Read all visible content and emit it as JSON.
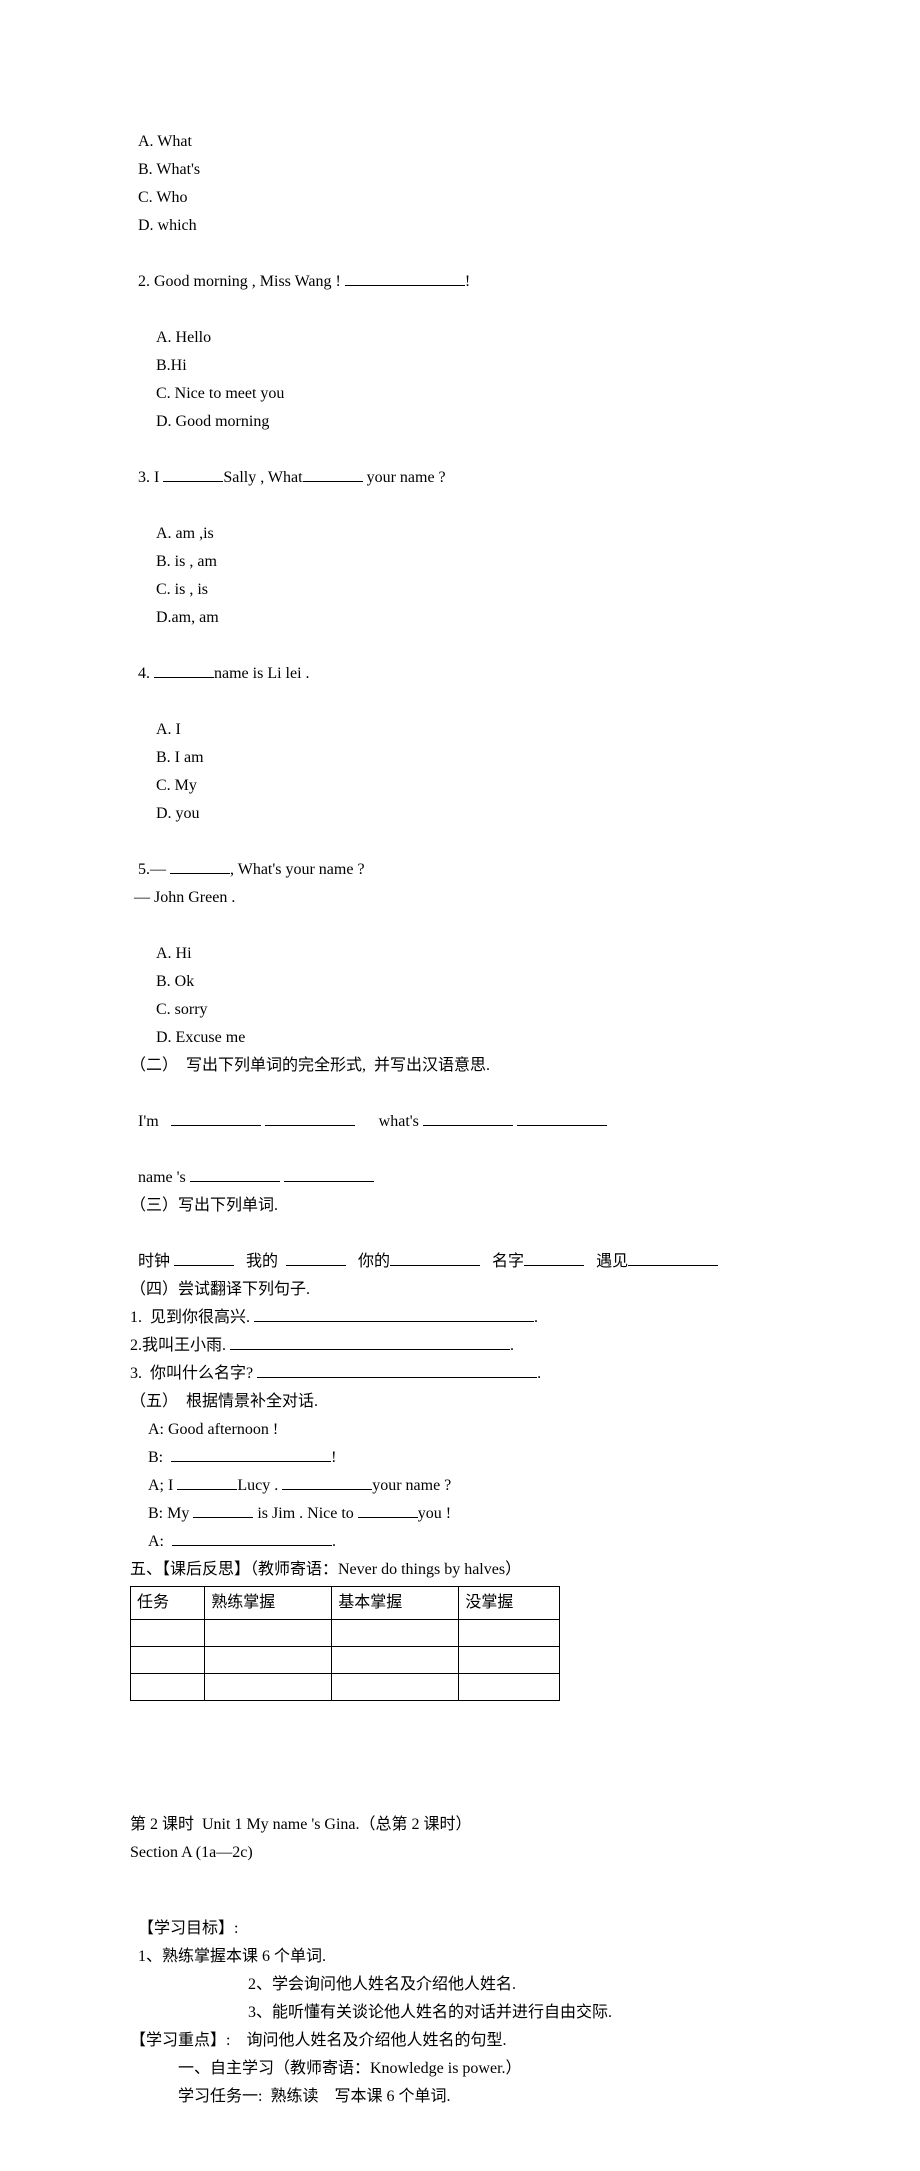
{
  "q1": {
    "a": "A. What",
    "b": "B. What's",
    "c": "C. Who",
    "d": "D. which"
  },
  "q2": {
    "stem_pre": "2. Good morning , Miss Wang ! ",
    "stem_post": "!",
    "a": "A. Hello",
    "b": "B.Hi",
    "c": "C. Nice to meet you",
    "d": "D. Good morning"
  },
  "q3": {
    "stem_pre": "3. I ",
    "stem_mid": "Sally , What",
    "stem_post": " your name ?",
    "a": "A. am ,is",
    "b": "B. is , am",
    "c": "C. is , is",
    "d": "D.am, am"
  },
  "q4": {
    "stem_post": "name is Li lei .",
    "stem_pre": "4. ",
    "a": "A. I",
    "b": "B. I am",
    "c": "C. My",
    "d": "D. you"
  },
  "q5": {
    "stem_pre": "5.— ",
    "stem_post": ", What's your name ?",
    "line2": " — John Green .",
    "a": "A. Hi",
    "b": "B. Ok",
    "c": "C. sorry",
    "d": "D. Excuse me"
  },
  "part2": {
    "title": "（二）  写出下列单词的完全形式,  并写出汉语意思.",
    "im": "I'm   ",
    "whats": "      what's ",
    "names": "name 's "
  },
  "part3": {
    "title": "（三）写出下列单词.",
    "w1": "时钟 ",
    "w2": "   我的  ",
    "w3": "   你的",
    "w4": "   名字",
    "w5": "   遇见"
  },
  "part4": {
    "title": "（四）尝试翻译下列句子.",
    "s1": "1.  见到你很高兴. ",
    "s2": "2.我叫王小雨. ",
    "s3": "3.  你叫什么名字? "
  },
  "part5": {
    "title": "（五）  根据情景补全对话.",
    "a1": "A: Good afternoon !",
    "b1_pre": "B:  ",
    "b1_post": "!",
    "a2_pre": "A; I ",
    "a2_mid": "Lucy . ",
    "a2_post": "your name ?",
    "b2_pre": "B: My ",
    "b2_mid": " is Jim . Nice to ",
    "b2_post": "you !",
    "a3_pre": "A:  "
  },
  "reflect": {
    "title": "五、【课后反思】（教师寄语：Never do things by halves）",
    "h1": "任务",
    "h2": "熟练掌握",
    "h3": "基本掌握",
    "h4": "没掌握"
  },
  "lesson2": {
    "line1": "第 2 课时  Unit 1 My name 's Gina.（总第 2 课时）",
    "line2": "Section A (1a—2c)",
    "obj_title": "【学习目标】:",
    "obj1": "1、熟练掌握本课 6 个单词.",
    "obj2": "2、学会询问他人姓名及介绍他人姓名.",
    "obj3": "3、能听懂有关谈论他人姓名的对话并进行自由交际.",
    "focus": "【学习重点】:    询问他人姓名及介绍他人姓名的句型.",
    "sub1": "一、自主学习（教师寄语：Knowledge is power.）",
    "sub2": "学习任务一:  熟练读    写本课 6 个单词."
  }
}
